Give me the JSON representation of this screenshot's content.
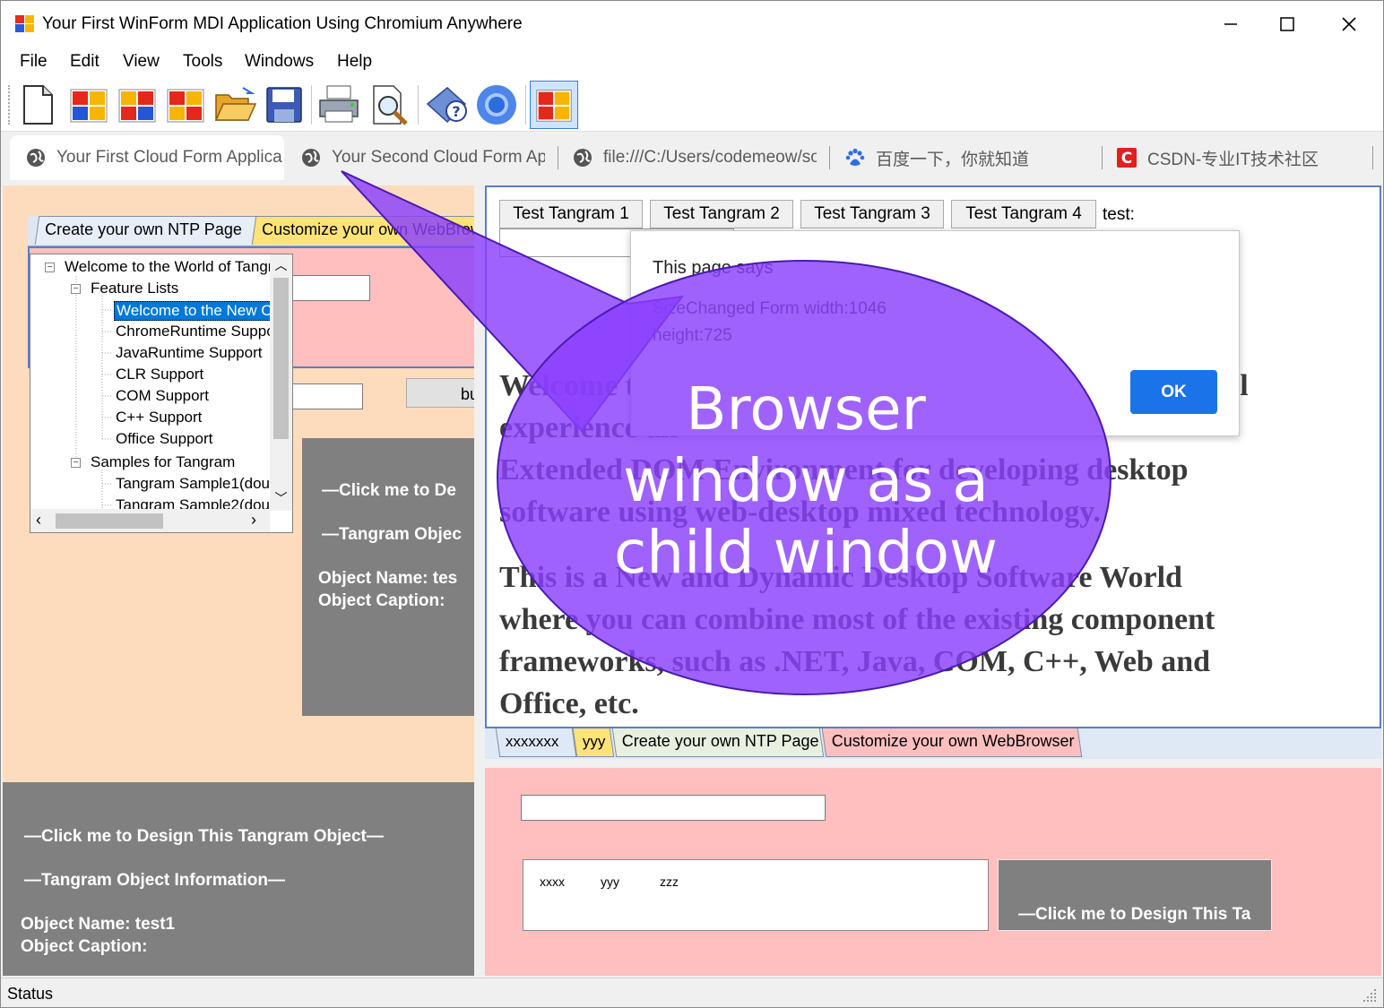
{
  "window": {
    "title": "Your First WinForm MDI Application Using Chromium Anywhere",
    "minimize": "—",
    "maximize": "☐",
    "close": "✕"
  },
  "menu": [
    "File",
    "Edit",
    "View",
    "Tools",
    "Windows",
    "Help"
  ],
  "toolbar": {
    "icons": [
      "new-document-icon",
      "tangram-window-icon",
      "tangram-window-icon",
      "tangram-window-icon",
      "open-folder-icon",
      "save-icon",
      "print-icon",
      "print-preview-icon",
      "help-icon",
      "chromium-icon",
      "tangram-window-icon"
    ]
  },
  "tabs": [
    {
      "label": "Your First Cloud Form Applica",
      "icon": "globe-icon",
      "active": true
    },
    {
      "label": "Your Second Cloud Form App",
      "icon": "globe-icon"
    },
    {
      "label": "file:///C:/Users/codemeow/so",
      "icon": "globe-icon"
    },
    {
      "label": "百度一下，你就知道",
      "icon": "baidu-paw-icon"
    },
    {
      "label": "CSDN-专业IT技术社区",
      "icon": "csdn-icon"
    }
  ],
  "left": {
    "tabs": [
      "Create your own NTP Page",
      "Customize your own WebBrow"
    ],
    "button_label": "bu",
    "tree": [
      {
        "label": "Welcome to the World of Tangr",
        "level": 0,
        "expander": "−"
      },
      {
        "label": "Feature Lists",
        "level": 1,
        "expander": "−"
      },
      {
        "label": "Welcome to the New C",
        "level": 2,
        "selected": true
      },
      {
        "label": "ChromeRuntime Suppor",
        "level": 2
      },
      {
        "label": "JavaRuntime Support",
        "level": 2
      },
      {
        "label": "CLR Support",
        "level": 2
      },
      {
        "label": "COM Support",
        "level": 2
      },
      {
        "label": "C++ Support",
        "level": 2
      },
      {
        "label": "Office Support",
        "level": 2
      },
      {
        "label": "Samples for Tangram",
        "level": 1,
        "expander": "−"
      },
      {
        "label": "Tangram Sample1(doub",
        "level": 2
      },
      {
        "label": "Tangram Sample2(doub",
        "level": 2
      }
    ],
    "design_small": {
      "line1": "—Click me to De",
      "line2": "—Tangram Objec",
      "name": "Object Name:   tes",
      "caption": "Object Caption:"
    },
    "design_big": {
      "line1": "—Click me to Design This Tangram Object—",
      "line2": "—Tangram Object Information—",
      "name": "Object Name:   test1",
      "caption": "Object Caption:"
    }
  },
  "browser": {
    "buttons": [
      "Test Tangram 1",
      "Test Tangram 2",
      "Test Tangram 3",
      "Test Tangram 4"
    ],
    "test_label": "test:",
    "lines": [
      "Welcome to the New Programming World, where you will experience an",
      "Extended DOM Environment for developing desktop",
      "software using web-desktop mixed technology.",
      "This is a New and Dynamic Desktop Software World",
      "where you can combine most of the existing component",
      "frameworks, such as .NET, Java, COM, C++, Web and",
      "Office, etc."
    ]
  },
  "dialog": {
    "title": "This page says",
    "message_line1": "SizeChanged Form width:1046",
    "message_line2": "height:725",
    "ok": "OK"
  },
  "bottom": {
    "tabs": [
      "xxxxxxx",
      "yyy",
      "Create your own NTP Page",
      "Customize your own WebBrowser"
    ],
    "columns": [
      "xxxx",
      "yyy",
      "zzz"
    ],
    "design_text": "—Click me to Design This Ta"
  },
  "status": "Status",
  "callout": {
    "line1": "Browser",
    "line2": "window as a",
    "line3": "child window",
    "color": "#8a3ffc"
  }
}
